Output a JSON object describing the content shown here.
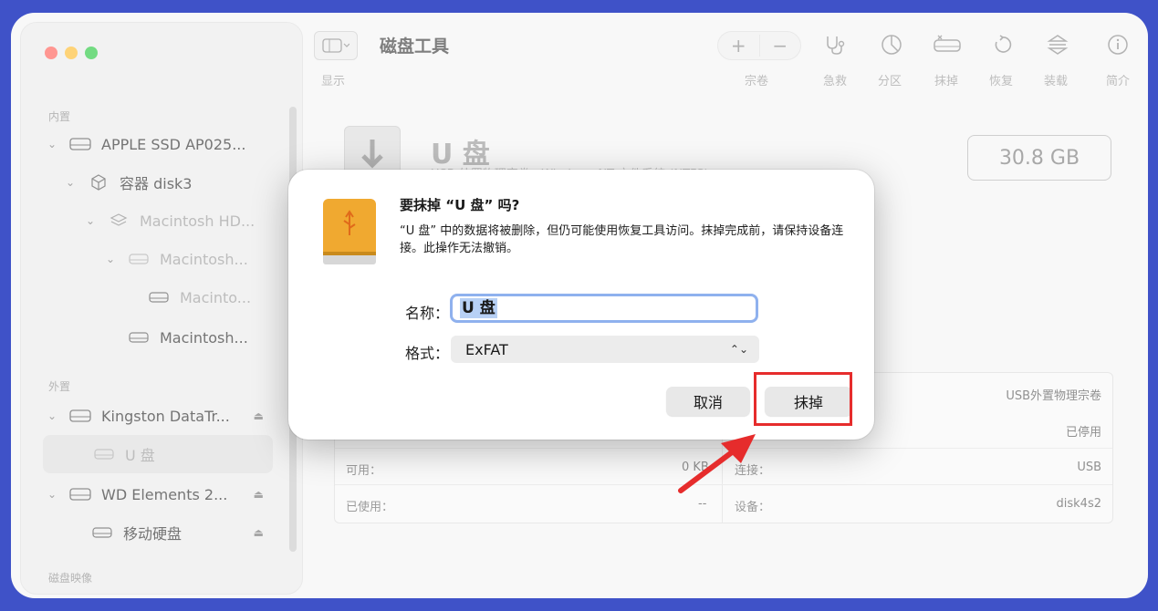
{
  "window": {
    "title": "磁盘工具"
  },
  "toolbar": {
    "view_label": "显示",
    "items": [
      {
        "id": "volume",
        "label": "宗卷",
        "icon": "plus-minus-icon"
      },
      {
        "id": "firstaid",
        "label": "急救",
        "icon": "stethoscope-icon"
      },
      {
        "id": "partition",
        "label": "分区",
        "icon": "pie-chart-icon"
      },
      {
        "id": "erase",
        "label": "抹掉",
        "icon": "erase-disk-icon"
      },
      {
        "id": "restore",
        "label": "恢复",
        "icon": "restore-icon"
      },
      {
        "id": "mount",
        "label": "装载",
        "icon": "mount-icon"
      },
      {
        "id": "info",
        "label": "简介",
        "icon": "info-icon"
      }
    ]
  },
  "sidebar": {
    "internal_label": "内置",
    "external_label": "外置",
    "images_label": "磁盘映像",
    "items": [
      {
        "label": "APPLE SSD AP025..."
      },
      {
        "label": "容器 disk3"
      },
      {
        "label": "Macintosh HD..."
      },
      {
        "label": "Macintosh..."
      },
      {
        "label": "Macinto..."
      },
      {
        "label": "Macintosh..."
      },
      {
        "label": "Kingston DataTr..."
      },
      {
        "label": "U 盘"
      },
      {
        "label": "WD Elements 2..."
      },
      {
        "label": "移动硬盘"
      }
    ]
  },
  "volume": {
    "name": "U 盘",
    "subtitle": "USB 外置物理宗卷 · Windows NT 文件系统 (NTFS)",
    "size": "30.8 GB"
  },
  "info": {
    "rows_right": [
      {
        "label": "",
        "value": "USB外置物理宗卷"
      },
      {
        "label": "",
        "value": "已停用"
      },
      {
        "label": "连接：",
        "value": "USB"
      },
      {
        "label": "设备：",
        "value": "disk4s2"
      }
    ],
    "rows_left": [
      {
        "label": "可用：",
        "value": "0 KB"
      },
      {
        "label": "已使用：",
        "value": "--"
      }
    ]
  },
  "dialog": {
    "title": "要抹掉 “U 盘” 吗?",
    "message": "“U 盘” 中的数据将被删除，但仍可能使用恢复工具访问。抹掉完成前，请保持设备连接。此操作无法撤销。",
    "name_label": "名称：",
    "name_value": "U 盘",
    "format_label": "格式：",
    "format_value": "ExFAT",
    "cancel_label": "取消",
    "erase_label": "抹掉"
  },
  "colors": {
    "highlight_box": "#e62c2c",
    "accent": "#8fb1ee",
    "background": "#3f52c8"
  }
}
